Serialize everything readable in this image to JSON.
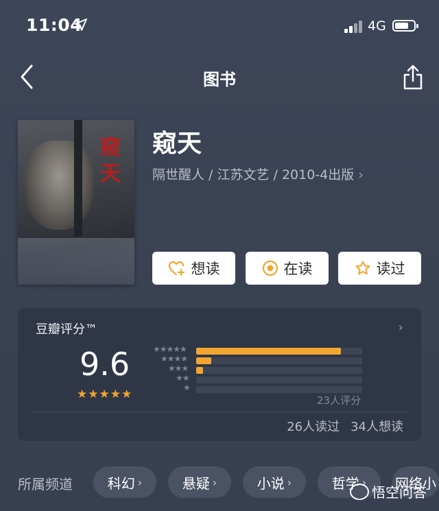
{
  "status_bar": {
    "time": "11:04",
    "network": "4G",
    "battery_level": 0.7
  },
  "nav": {
    "title": "图书"
  },
  "book": {
    "cover_title": "窥天",
    "title": "窥天",
    "meta": "隔世醒人 / 江苏文艺 / 2010-4出版",
    "actions": [
      {
        "label": "想读",
        "icon": "heart-plus-icon"
      },
      {
        "label": "在读",
        "icon": "circle-dot-icon"
      },
      {
        "label": "读过",
        "icon": "star-outline-icon"
      }
    ]
  },
  "rating": {
    "title": "豆瓣评分™",
    "score": "9.6",
    "stars": "★★★★★",
    "distribution": [
      {
        "stars": "★★★★★",
        "fraction": 0.87
      },
      {
        "stars": "★★★★",
        "fraction": 0.09
      },
      {
        "stars": "★★★",
        "fraction": 0.04
      },
      {
        "stars": "★★",
        "fraction": 0.0
      },
      {
        "stars": "★",
        "fraction": 0.0
      }
    ],
    "count": "23人评分",
    "read": "26人读过",
    "want": "34人想读"
  },
  "categories": {
    "label": "所属频道",
    "items": [
      "科幻",
      "悬疑",
      "小说",
      "哲学",
      "网络小"
    ]
  },
  "watermark": "悟空问答",
  "colors": {
    "accent": "#f2a62f",
    "card": "#2f3645",
    "chip": "#4b5263"
  }
}
